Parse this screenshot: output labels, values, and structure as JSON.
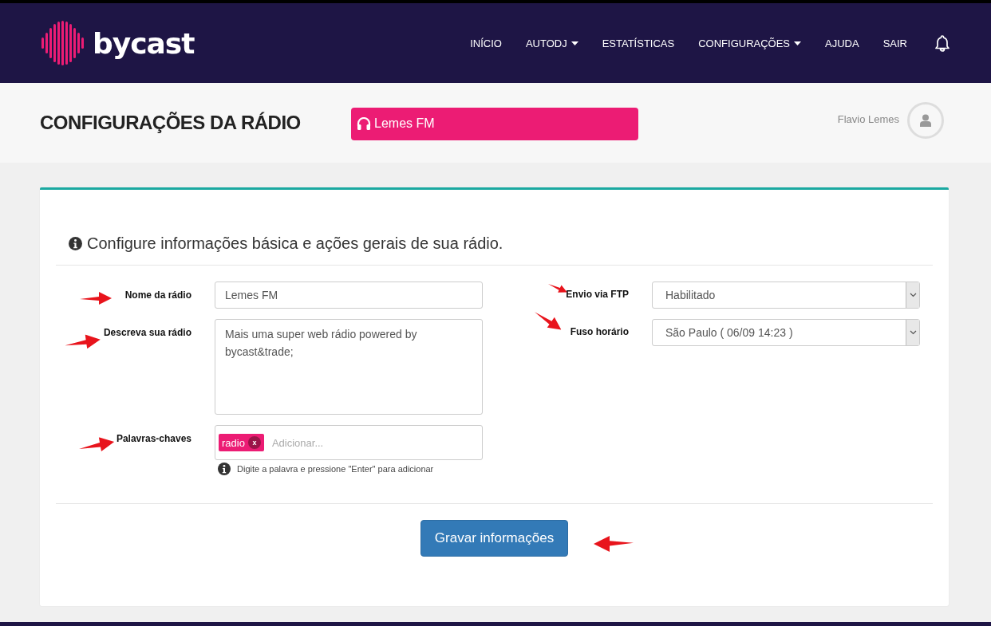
{
  "brand": {
    "name": "bycast"
  },
  "nav": [
    {
      "label": "INÍCIO",
      "has_menu": false
    },
    {
      "label": "AUTODJ",
      "has_menu": true
    },
    {
      "label": "ESTATÍSTICAS",
      "has_menu": false
    },
    {
      "label": "CONFIGURAÇÕES",
      "has_menu": true
    },
    {
      "label": "AJUDA",
      "has_menu": false
    },
    {
      "label": "SAIR",
      "has_menu": false
    }
  ],
  "header": {
    "title": "CONFIGURAÇÕES DA RÁDIO",
    "radio": "Lemes FM",
    "user": "Flavio Lemes"
  },
  "intro": "Configure informações básica e ações gerais de sua rádio.",
  "left_fields": [
    {
      "kind": "text",
      "label": "Nome da rádio",
      "value": "Lemes FM"
    },
    {
      "kind": "textarea",
      "label": "Descreva sua rádio",
      "value": "Mais uma super web rádio powered by bycast&trade;"
    },
    {
      "kind": "tags",
      "label": "Palavras-chaves",
      "tags": [
        "radio"
      ],
      "remove": "x",
      "placeholder": "Adicionar...",
      "hint": "Digite a palavra e pressione \"Enter\" para adicionar"
    }
  ],
  "right_fields": [
    {
      "kind": "select",
      "label": "Envio via FTP",
      "value": "Habilitado"
    },
    {
      "kind": "select",
      "label": "Fuso horário",
      "value": "São Paulo ( 06/09 14:23 )"
    }
  ],
  "submit": "Gravar informações"
}
